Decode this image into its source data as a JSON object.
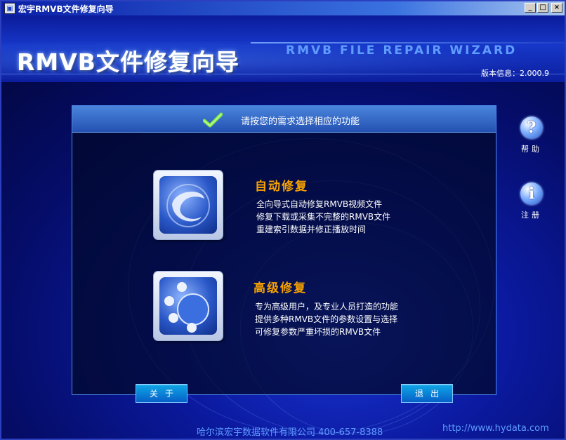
{
  "window": {
    "title": "宏宇RMVB文件修复向导",
    "minimize": "_",
    "maximize": "□",
    "close": "×"
  },
  "header": {
    "title": "RMVB文件修复向导",
    "subtitle_en": "RMVB FILE REPAIR WIZARD",
    "version": "版本信息：2.000.9"
  },
  "panel": {
    "title": "请按您的需求选择相应的功能",
    "options": [
      {
        "title": "自动修复",
        "lines": [
          "全向导式自动修复RMVB视频文件",
          "修复下载或采集不完整的RMVB文件",
          "重建索引数据并修正播放时间"
        ]
      },
      {
        "title": "高级修复",
        "lines": [
          "专为高级用户，及专业人员打造的功能",
          "提供多种RMVB文件的参数设置与选择",
          "可修复参数严重坏损的RMVB文件"
        ]
      }
    ],
    "about_button": "关于",
    "exit_button": "退出"
  },
  "side": {
    "help_label": "帮助",
    "register_label": "注册",
    "help_symbol": "?",
    "register_symbol": "i"
  },
  "footer": {
    "company": "哈尔滨宏宇数据软件有限公司 400-657-8388",
    "url": "http://www.hydata.com"
  },
  "colors": {
    "accent_orange": "#f7a300",
    "link_blue": "#5f9cff",
    "panel_header": "#2f63c4"
  }
}
